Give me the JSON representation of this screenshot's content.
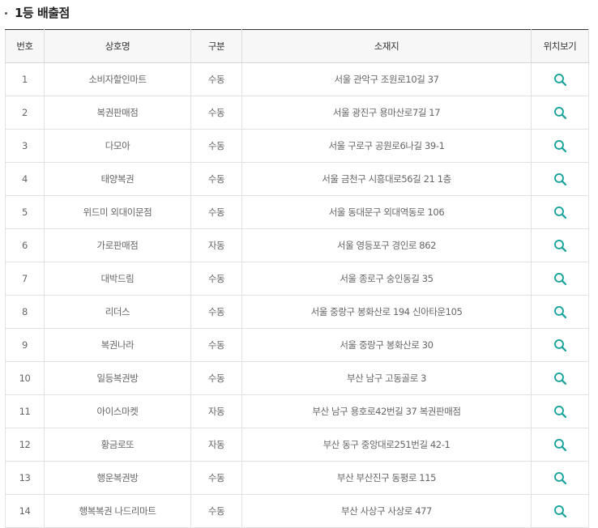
{
  "section": {
    "title": "1등 배출점"
  },
  "table": {
    "headers": {
      "no": "번호",
      "name": "상호명",
      "type": "구분",
      "address": "소재지",
      "location": "위치보기"
    },
    "rows": [
      {
        "no": "1",
        "name": "소비자할인마트",
        "type": "수동",
        "address": "서울 관악구 조원로10길 37"
      },
      {
        "no": "2",
        "name": "복권판매점",
        "type": "수동",
        "address": "서울 광진구 용마산로7길 17"
      },
      {
        "no": "3",
        "name": "다모아",
        "type": "수동",
        "address": "서울 구로구 공원로6나길 39-1"
      },
      {
        "no": "4",
        "name": "태양복권",
        "type": "수동",
        "address": "서울 금천구 시흥대로56길 21 1층"
      },
      {
        "no": "5",
        "name": "위드미 외대이문점",
        "type": "수동",
        "address": "서울 동대문구 외대역동로 106"
      },
      {
        "no": "6",
        "name": "가로판매점",
        "type": "자동",
        "address": "서울 영등포구 경인로 862"
      },
      {
        "no": "7",
        "name": "대박드림",
        "type": "수동",
        "address": "서울 종로구 숭인동길 35"
      },
      {
        "no": "8",
        "name": "리더스",
        "type": "수동",
        "address": "서울 중랑구 봉화산로 194 신아타운105"
      },
      {
        "no": "9",
        "name": "복권나라",
        "type": "수동",
        "address": "서울 중랑구 봉화산로 30"
      },
      {
        "no": "10",
        "name": "일등복권방",
        "type": "수동",
        "address": "부산 남구 고동골로 3"
      },
      {
        "no": "11",
        "name": "아이스마켓",
        "type": "자동",
        "address": "부산 남구 용호로42번길 37 복권판매점"
      },
      {
        "no": "12",
        "name": "황금로또",
        "type": "자동",
        "address": "부산 동구 중앙대로251번길 42-1"
      },
      {
        "no": "13",
        "name": "행운복권방",
        "type": "수동",
        "address": "부산 부산진구 동평로 115"
      },
      {
        "no": "14",
        "name": "행복복권 나드리마트",
        "type": "수동",
        "address": "부산 사상구 사상로 477"
      }
    ]
  },
  "icons": {
    "location": "search-icon"
  },
  "colors": {
    "accent": "#1aa39a",
    "header_bg": "#f7f7f7",
    "border": "#e2e2e2"
  }
}
